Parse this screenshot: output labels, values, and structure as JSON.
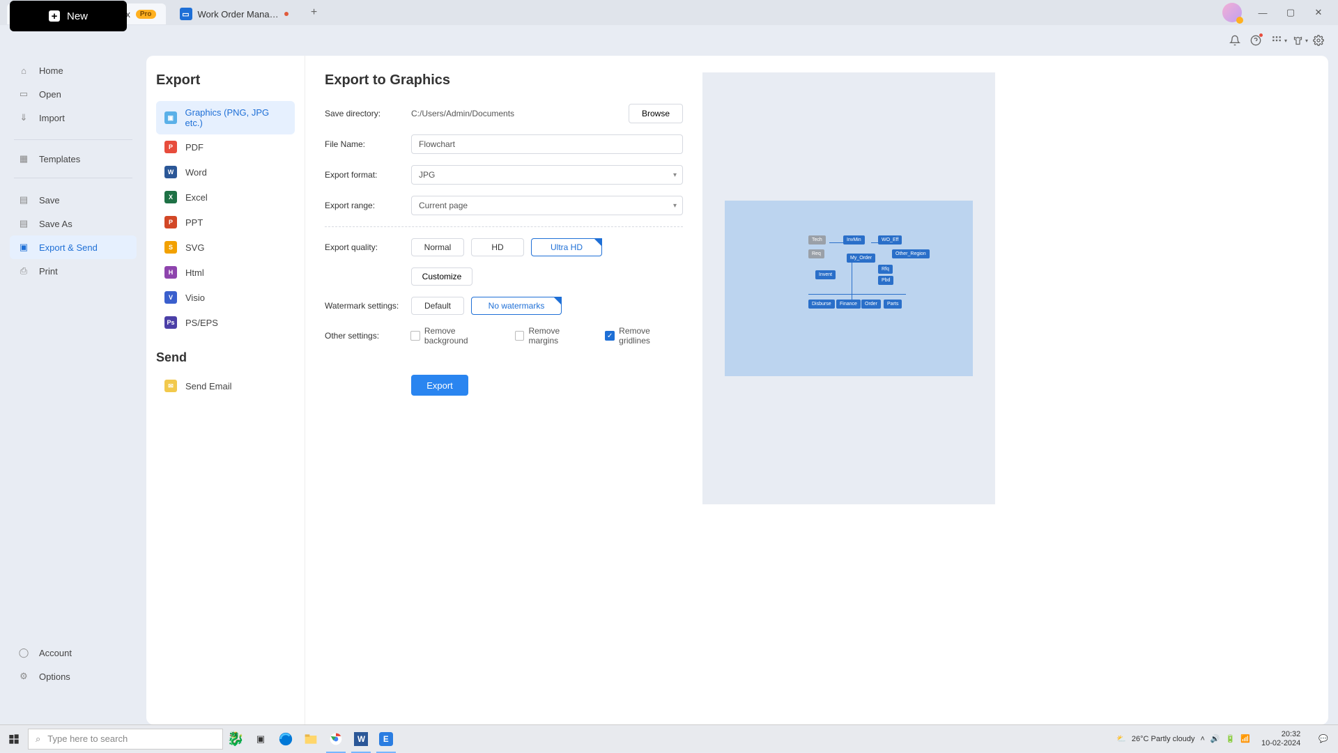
{
  "titlebar": {
    "tabs": [
      {
        "label": "Wondershare EdrawMax",
        "badge": "Pro"
      },
      {
        "label": "Work Order Mana…"
      }
    ]
  },
  "new_button": "New",
  "sidebar": {
    "items": [
      {
        "label": "Home"
      },
      {
        "label": "Open"
      },
      {
        "label": "Import"
      },
      {
        "label": "Templates"
      },
      {
        "label": "Save"
      },
      {
        "label": "Save As"
      },
      {
        "label": "Export & Send"
      },
      {
        "label": "Print"
      }
    ],
    "bottom": [
      {
        "label": "Account"
      },
      {
        "label": "Options"
      }
    ]
  },
  "export_list": {
    "heading": "Export",
    "items": [
      {
        "label": "Graphics (PNG, JPG etc.)"
      },
      {
        "label": "PDF"
      },
      {
        "label": "Word"
      },
      {
        "label": "Excel"
      },
      {
        "label": "PPT"
      },
      {
        "label": "SVG"
      },
      {
        "label": "Html"
      },
      {
        "label": "Visio"
      },
      {
        "label": "PS/EPS"
      }
    ],
    "send_heading": "Send",
    "send_items": [
      {
        "label": "Send Email"
      }
    ]
  },
  "form": {
    "heading": "Export to Graphics",
    "save_dir_label": "Save directory:",
    "save_dir_value": "C:/Users/Admin/Documents",
    "browse": "Browse",
    "filename_label": "File Name:",
    "filename_value": "Flowchart",
    "format_label": "Export format:",
    "format_value": "JPG",
    "range_label": "Export range:",
    "range_value": "Current page",
    "quality_label": "Export quality:",
    "quality": [
      "Normal",
      "HD",
      "Ultra HD"
    ],
    "customize": "Customize",
    "watermark_label": "Watermark settings:",
    "watermark": [
      "Default",
      "No watermarks"
    ],
    "other_label": "Other settings:",
    "other": [
      {
        "label": "Remove background",
        "checked": false
      },
      {
        "label": "Remove margins",
        "checked": false
      },
      {
        "label": "Remove gridlines",
        "checked": true
      }
    ],
    "export": "Export"
  },
  "taskbar": {
    "search_placeholder": "Type here to search",
    "weather": "26°C  Partly cloudy",
    "time": "20:32",
    "date": "10-02-2024"
  },
  "colors": {
    "accent": "#1e6fd6"
  }
}
